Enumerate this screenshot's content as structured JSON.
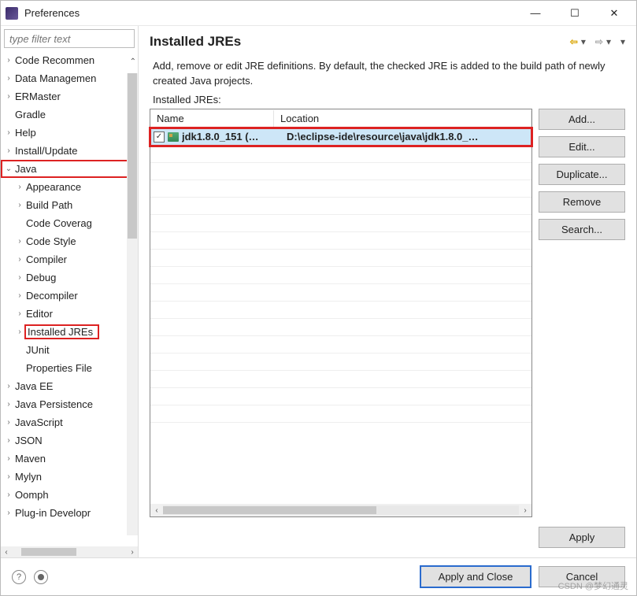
{
  "window": {
    "title": "Preferences"
  },
  "filter": {
    "placeholder": "type filter text"
  },
  "tree": [
    {
      "label": "Code Recommen",
      "expand": "collapsed",
      "depth": 0
    },
    {
      "label": "Data Managemen",
      "expand": "collapsed",
      "depth": 0
    },
    {
      "label": "ERMaster",
      "expand": "collapsed",
      "depth": 0
    },
    {
      "label": "Gradle",
      "expand": "none",
      "depth": 0
    },
    {
      "label": "Help",
      "expand": "collapsed",
      "depth": 0
    },
    {
      "label": "Install/Update",
      "expand": "collapsed",
      "depth": 0
    },
    {
      "label": "Java",
      "expand": "expanded",
      "depth": 0,
      "highlight": true
    },
    {
      "label": "Appearance",
      "expand": "collapsed",
      "depth": 1
    },
    {
      "label": "Build Path",
      "expand": "collapsed",
      "depth": 1
    },
    {
      "label": "Code Coverag",
      "expand": "none",
      "depth": 1
    },
    {
      "label": "Code Style",
      "expand": "collapsed",
      "depth": 1
    },
    {
      "label": "Compiler",
      "expand": "collapsed",
      "depth": 1
    },
    {
      "label": "Debug",
      "expand": "collapsed",
      "depth": 1
    },
    {
      "label": "Decompiler",
      "expand": "collapsed",
      "depth": 1
    },
    {
      "label": "Editor",
      "expand": "collapsed",
      "depth": 1
    },
    {
      "label": "Installed JREs",
      "expand": "collapsed",
      "depth": 1,
      "selected": true
    },
    {
      "label": "JUnit",
      "expand": "none",
      "depth": 1
    },
    {
      "label": "Properties File",
      "expand": "none",
      "depth": 1
    },
    {
      "label": "Java EE",
      "expand": "collapsed",
      "depth": 0
    },
    {
      "label": "Java Persistence",
      "expand": "collapsed",
      "depth": 0
    },
    {
      "label": "JavaScript",
      "expand": "collapsed",
      "depth": 0
    },
    {
      "label": "JSON",
      "expand": "collapsed",
      "depth": 0
    },
    {
      "label": "Maven",
      "expand": "collapsed",
      "depth": 0
    },
    {
      "label": "Mylyn",
      "expand": "collapsed",
      "depth": 0
    },
    {
      "label": "Oomph",
      "expand": "collapsed",
      "depth": 0
    },
    {
      "label": "Plug-in Developr",
      "expand": "collapsed",
      "depth": 0
    }
  ],
  "page": {
    "title": "Installed JREs",
    "description": "Add, remove or edit JRE definitions. By default, the checked JRE is added to the build path of newly created Java projects.",
    "list_label": "Installed JREs:",
    "columns": {
      "name": "Name",
      "location": "Location"
    },
    "row": {
      "checked": true,
      "name": "jdk1.8.0_151 (…",
      "location": "D:\\eclipse-ide\\resource\\java\\jdk1.8.0_…"
    },
    "buttons": {
      "add": "Add...",
      "edit": "Edit...",
      "duplicate": "Duplicate...",
      "remove": "Remove",
      "search": "Search..."
    },
    "apply": "Apply"
  },
  "footer": {
    "apply_close": "Apply and Close",
    "cancel": "Cancel",
    "help": "?"
  },
  "watermark": "CSDN @梦幻通灵"
}
